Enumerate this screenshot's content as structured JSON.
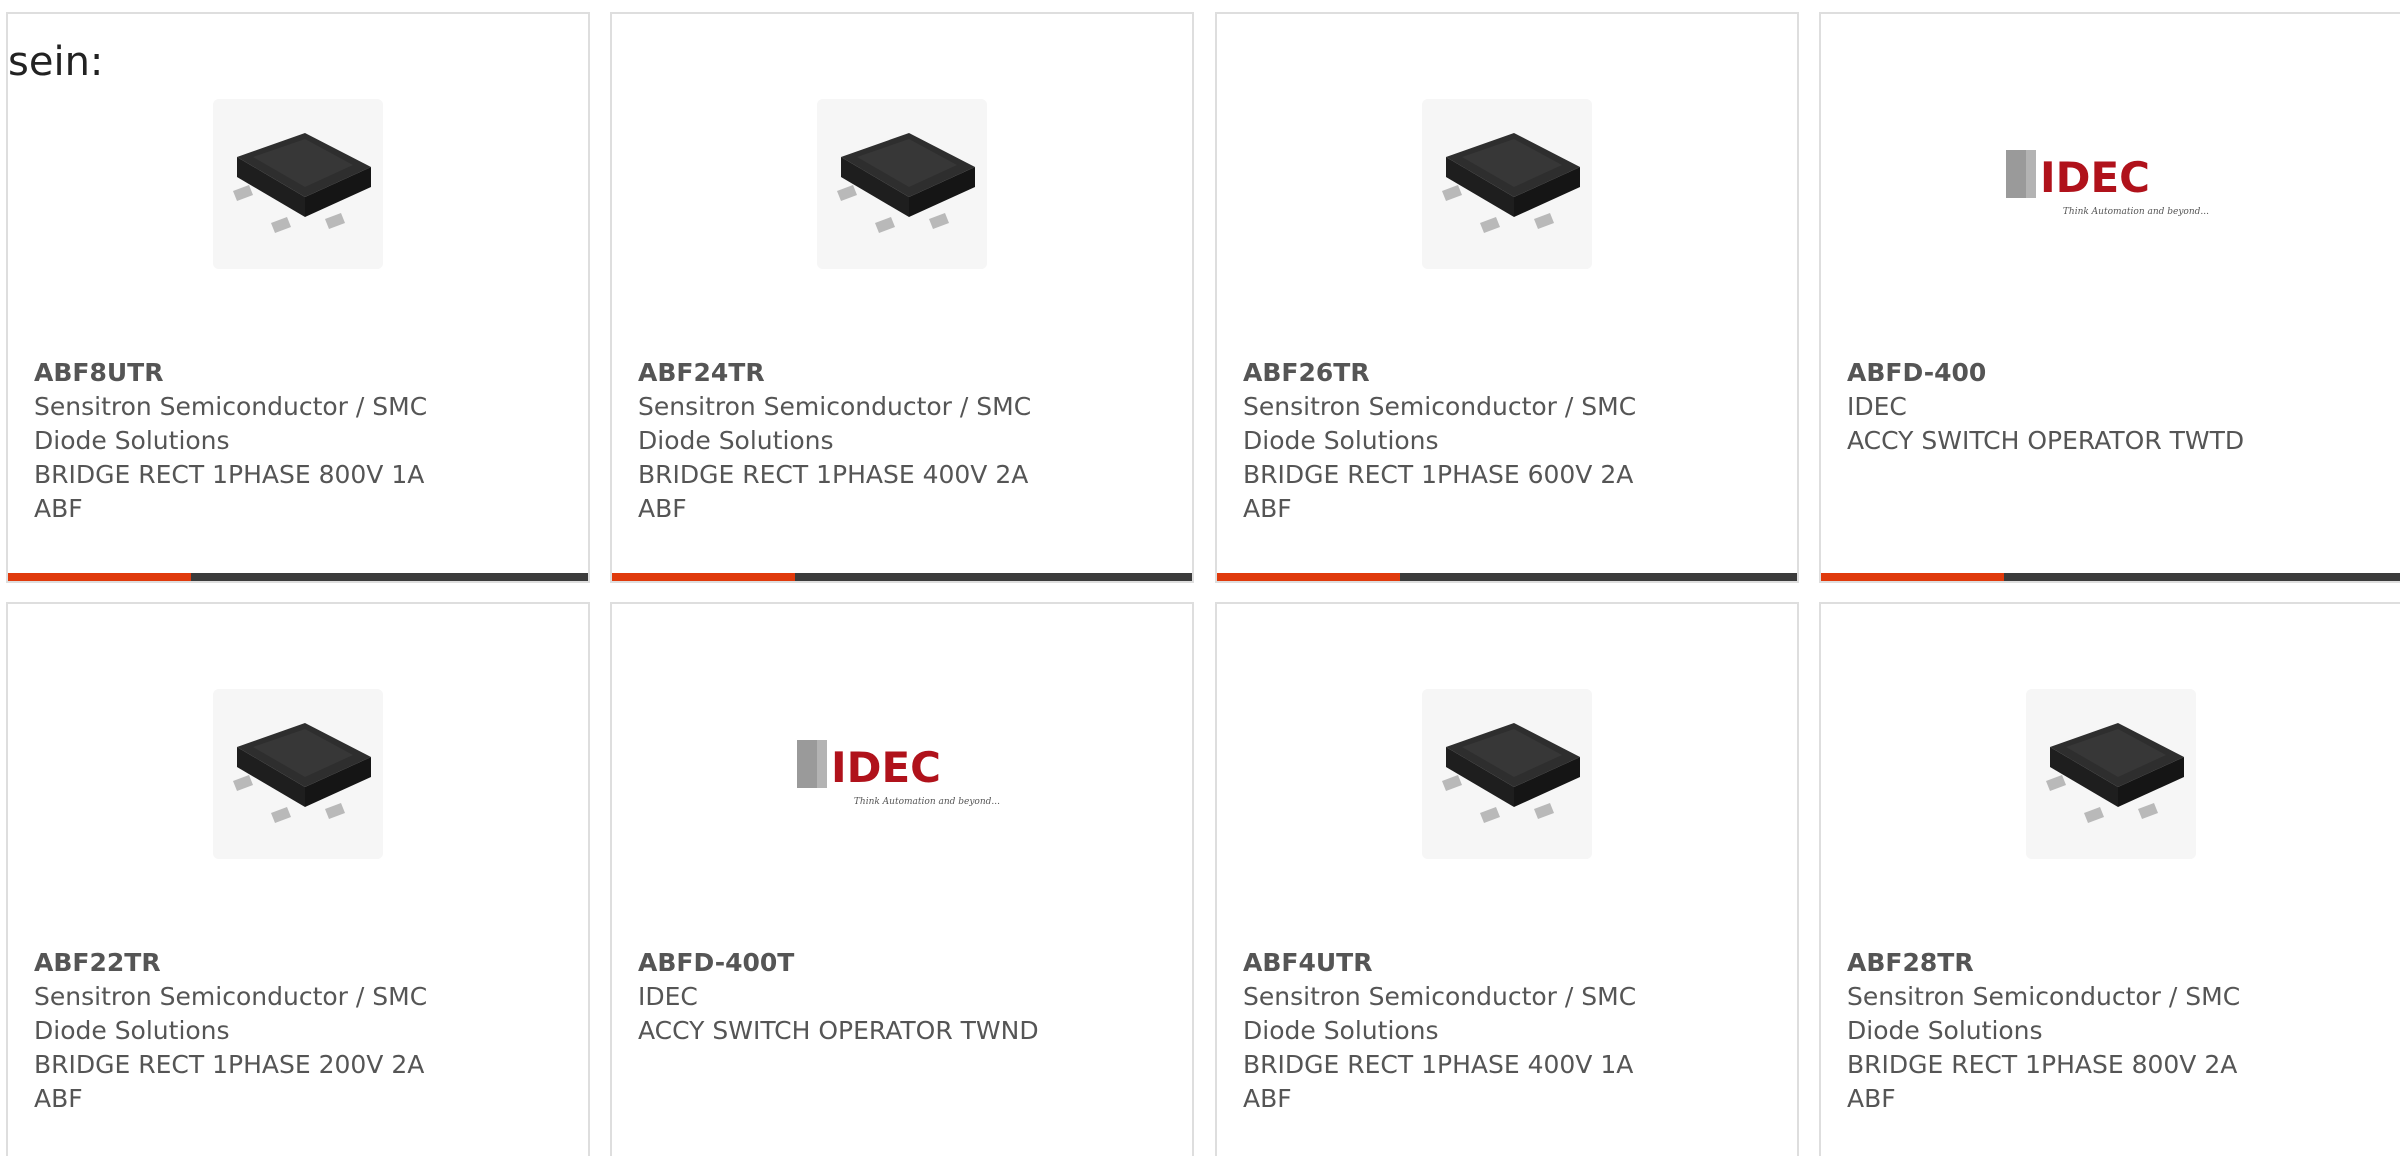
{
  "intro_text": "sein:",
  "accent_color": "#e03a0c",
  "bar_color": "#3b3b3b",
  "products": [
    {
      "part_number": "ABF8UTR",
      "manufacturer": "Sensitron Semiconductor / SMC Diode Solutions",
      "description": "BRIDGE RECT 1PHASE 800V 1A ABF",
      "image": "bridge-rectifier-chip-icon"
    },
    {
      "part_number": "ABF24TR",
      "manufacturer": "Sensitron Semiconductor / SMC Diode Solutions",
      "description": "BRIDGE RECT 1PHASE 400V 2A ABF",
      "image": "bridge-rectifier-chip-icon"
    },
    {
      "part_number": "ABF26TR",
      "manufacturer": "Sensitron Semiconductor / SMC Diode Solutions",
      "description": "BRIDGE RECT 1PHASE 600V 2A ABF",
      "image": "bridge-rectifier-chip-icon"
    },
    {
      "part_number": "ABFD-400",
      "manufacturer": "IDEC",
      "description": "ACCY SWITCH OPERATOR TWTD",
      "image": "idec-logo",
      "logo_text": "IDEC",
      "logo_tagline": "Think Automation and beyond..."
    },
    {
      "part_number": "ABF22TR",
      "manufacturer": "Sensitron Semiconductor / SMC Diode Solutions",
      "description": "BRIDGE RECT 1PHASE 200V 2A ABF",
      "image": "bridge-rectifier-chip-icon"
    },
    {
      "part_number": "ABFD-400T",
      "manufacturer": "IDEC",
      "description": "ACCY SWITCH OPERATOR TWND",
      "image": "idec-logo",
      "logo_text": "IDEC",
      "logo_tagline": "Think Automation and beyond..."
    },
    {
      "part_number": "ABF4UTR",
      "manufacturer": "Sensitron Semiconductor / SMC Diode Solutions",
      "description": "BRIDGE RECT 1PHASE 400V 1A ABF",
      "image": "bridge-rectifier-chip-icon"
    },
    {
      "part_number": "ABF28TR",
      "manufacturer": "Sensitron Semiconductor / SMC Diode Solutions",
      "description": "BRIDGE RECT 1PHASE 800V 2A ABF",
      "image": "bridge-rectifier-chip-icon"
    }
  ]
}
